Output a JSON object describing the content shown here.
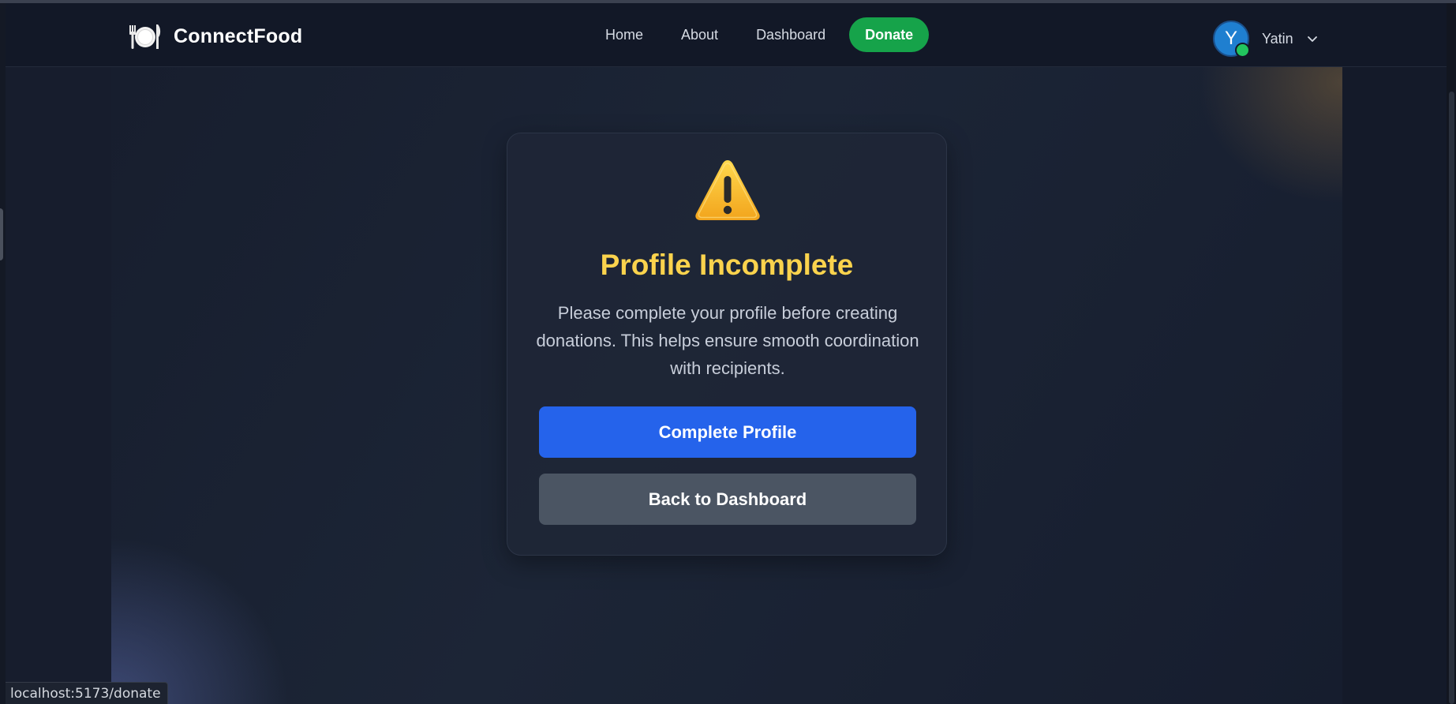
{
  "nav": {
    "brand_name": "ConnectFood",
    "brand_icon": "plate-cutlery-icon",
    "links": [
      "Home",
      "About",
      "Dashboard"
    ],
    "donate_label": "Donate"
  },
  "user": {
    "initial": "Y",
    "name": "Yatin",
    "status": "online"
  },
  "card": {
    "icon": "warning-icon",
    "title": "Profile Incomplete",
    "description": "Please complete your profile before creating donations. This helps ensure smooth coordination with recipients.",
    "primary_button": "Complete Profile",
    "secondary_button": "Back to Dashboard"
  },
  "status_bar": {
    "url": "localhost:5173/donate"
  },
  "colors": {
    "accent_blue": "#2563eb",
    "donate_green": "#16a34a",
    "title_yellow": "#fbd34d",
    "secondary_gray": "#4b5563"
  }
}
